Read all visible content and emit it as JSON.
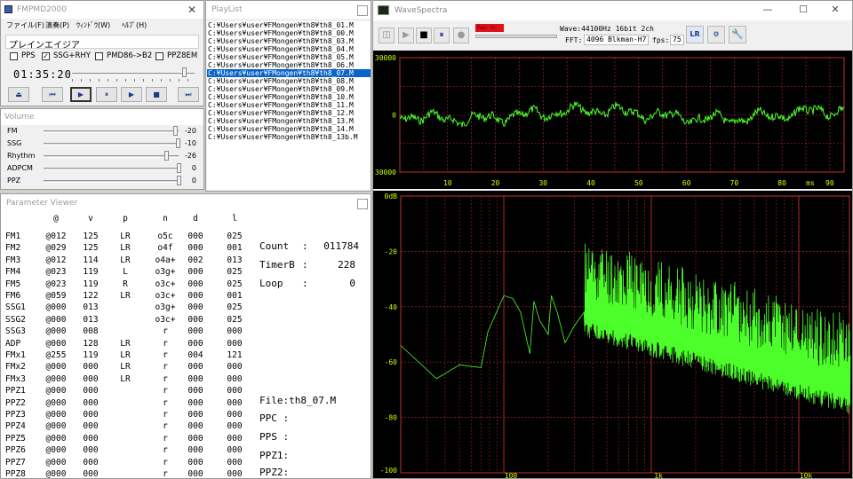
{
  "fmpmd": {
    "title": "FMPMD2000",
    "menu": [
      "ファイル(F)",
      "演奏(P)",
      "ｳｨﾝﾄﾞｳ(W)",
      "ﾍﾙﾌﾟ(H)"
    ],
    "song_title": "プレインエイジア",
    "checks": [
      {
        "label": "PPS",
        "checked": false
      },
      {
        "label": "SSG+RHY",
        "checked": true
      },
      {
        "label": "PMD86->B2",
        "checked": false
      },
      {
        "label": "PPZ8EM",
        "checked": false
      }
    ],
    "time": "01:35:20",
    "seek_position": 0.91,
    "controls": [
      {
        "name": "eject",
        "glyph": "⏏"
      },
      {
        "name": "prev",
        "glyph": "⏮"
      },
      {
        "name": "play",
        "glyph": "▶"
      },
      {
        "name": "pause",
        "glyph": "⏸"
      },
      {
        "name": "step",
        "glyph": "▶"
      },
      {
        "name": "stop",
        "glyph": "■"
      },
      {
        "name": "next",
        "glyph": "⏭"
      }
    ]
  },
  "volume": {
    "title": "Volume",
    "rows": [
      {
        "label": "FM",
        "value": "-20",
        "pos": 0.975
      },
      {
        "label": "SSG",
        "value": "-10",
        "pos": 0.99
      },
      {
        "label": "Rhythm",
        "value": "-26",
        "pos": 0.905
      },
      {
        "label": "ADPCM",
        "value": "0",
        "pos": 1.0
      },
      {
        "label": "PPZ",
        "value": "0",
        "pos": 1.0
      }
    ]
  },
  "playlist": {
    "title": "PlayList",
    "selected_index": 7,
    "items": [
      "C:¥Users¥user¥FMongen¥th8¥th8_01.M",
      "C:¥Users¥user¥FMongen¥th8¥th8_00.M",
      "C:¥Users¥user¥FMongen¥th8¥th8_03.M",
      "C:¥Users¥user¥FMongen¥th8¥th8_04.M",
      "C:¥Users¥user¥FMongen¥th8¥th8_05.M",
      "C:¥Users¥user¥FMongen¥th8¥th8_06.M",
      "C:¥Users¥user¥FMongen¥th8¥th8_07.M",
      "C:¥Users¥user¥FMongen¥th8¥th8_08.M",
      "C:¥Users¥user¥FMongen¥th8¥th8_09.M",
      "C:¥Users¥user¥FMongen¥th8¥th8_10.M",
      "C:¥Users¥user¥FMongen¥th8¥th8_11.M",
      "C:¥Users¥user¥FMongen¥th8¥th8_12.M",
      "C:¥Users¥user¥FMongen¥th8¥th8_13.M",
      "C:¥Users¥user¥FMongen¥th8¥th8_14.M",
      "C:¥Users¥user¥FMongen¥th8¥th8_13b.M"
    ]
  },
  "params": {
    "title": "Parameter Viewer",
    "headers": [
      "@",
      "v",
      "p",
      "n",
      "d",
      "l"
    ],
    "rows": [
      [
        "FM1",
        "@012",
        "125",
        "LR",
        "o5c",
        "000",
        "025"
      ],
      [
        "FM2",
        "@029",
        "125",
        "LR",
        "o4f",
        "000",
        "001"
      ],
      [
        "FM3",
        "@012",
        "114",
        "LR",
        "o4a+",
        "002",
        "013"
      ],
      [
        "FM4",
        "@023",
        "119",
        "L",
        "o3g+",
        "000",
        "025"
      ],
      [
        "FM5",
        "@023",
        "119",
        "R",
        "o3c+",
        "000",
        "025"
      ],
      [
        "FM6",
        "@059",
        "122",
        "LR",
        "o3c+",
        "000",
        "001"
      ],
      [
        "SSG1",
        "@000",
        "013",
        "",
        "o3g+",
        "000",
        "025"
      ],
      [
        "SSG2",
        "@000",
        "013",
        "",
        "o3c+",
        "000",
        "025"
      ],
      [
        "SSG3",
        "@000",
        "008",
        "",
        "r",
        "000",
        "000"
      ],
      [
        "ADP",
        "@000",
        "128",
        "LR",
        "r",
        "000",
        "000"
      ],
      [
        "FMx1",
        "@255",
        "119",
        "LR",
        "r",
        "004",
        "121"
      ],
      [
        "FMx2",
        "@000",
        "000",
        "LR",
        "r",
        "000",
        "000"
      ],
      [
        "FMx3",
        "@000",
        "000",
        "LR",
        "r",
        "000",
        "000"
      ],
      [
        "PPZ1",
        "@000",
        "000",
        "",
        "r",
        "000",
        "000"
      ],
      [
        "PPZ2",
        "@000",
        "000",
        "",
        "r",
        "000",
        "000"
      ],
      [
        "PPZ3",
        "@000",
        "000",
        "",
        "r",
        "000",
        "000"
      ],
      [
        "PPZ4",
        "@000",
        "000",
        "",
        "r",
        "000",
        "000"
      ],
      [
        "PPZ5",
        "@000",
        "000",
        "",
        "r",
        "000",
        "000"
      ],
      [
        "PPZ6",
        "@000",
        "000",
        "",
        "r",
        "000",
        "000"
      ],
      [
        "PPZ7",
        "@000",
        "000",
        "",
        "r",
        "000",
        "000"
      ],
      [
        "PPZ8",
        "@000",
        "000",
        "",
        "r",
        "000",
        "000"
      ]
    ],
    "stats": [
      {
        "label": "Count",
        "value": "011784"
      },
      {
        "label": "TimerB",
        "value": "228"
      },
      {
        "label": "Loop",
        "value": "0"
      }
    ],
    "file": "File:th8_07.M",
    "ppc": "PPC :",
    "pps": "PPS :",
    "ppz1": "PPZ1:",
    "ppz2": "PPZ2:"
  },
  "wavespectra": {
    "title": "WaveSpectra",
    "rec_label": "Rec. In",
    "wave_info": "Wave:44100Hz 16bit 2ch",
    "fft_label": "FFT:",
    "fft_value": "4096 Blkman-H7",
    "fps_label": "fps:",
    "fps_value": "75"
  },
  "chart_data": [
    {
      "type": "line",
      "name": "waveform",
      "x_unit": "ms",
      "x_range": [
        0,
        93
      ],
      "y_range": [
        -30000,
        30000
      ],
      "x_ticks": [
        "10",
        "20",
        "30",
        "40",
        "50",
        "60",
        "70",
        "80",
        "90"
      ],
      "x_unit_label": "ms",
      "y_ticks": [
        "30000",
        "0",
        "-30000"
      ],
      "color": "#4cff2a",
      "grid_color": "#c0302c",
      "background": "#000000"
    },
    {
      "type": "line",
      "name": "spectrum",
      "x_scale": "log",
      "y_unit": "dB",
      "y_range": [
        -100,
        0
      ],
      "y_ticks": [
        "0dB",
        "-20",
        "-40",
        "-60",
        "-80",
        "-100"
      ],
      "x_ticks": [
        "100",
        "1k",
        "10k"
      ],
      "points_low": [
        [
          20,
          -54
        ],
        [
          35,
          -66
        ],
        [
          50,
          -61
        ],
        [
          70,
          -62
        ],
        [
          78,
          -49
        ],
        [
          100,
          -36
        ],
        [
          115,
          -37
        ],
        [
          130,
          -42
        ],
        [
          150,
          -57
        ],
        [
          160,
          -38
        ],
        [
          175,
          -45
        ],
        [
          200,
          -50
        ],
        [
          210,
          -36
        ],
        [
          230,
          -42
        ],
        [
          260,
          -53
        ],
        [
          300,
          -47
        ],
        [
          350,
          -42
        ]
      ],
      "color": "#4cff2a",
      "grid_color": "#c0302c",
      "background": "#000000"
    }
  ]
}
